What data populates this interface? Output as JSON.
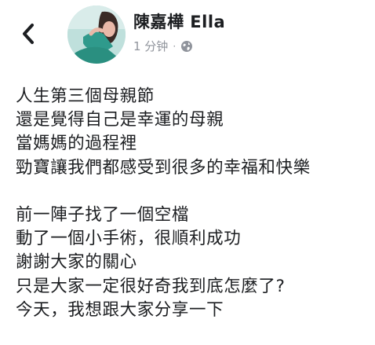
{
  "post": {
    "author_name": "陳嘉樺 Ella",
    "timestamp": "1 分钟",
    "separator": "·",
    "privacy_icon": "globe-icon",
    "paragraphs": [
      [
        "人生第三個母親節",
        "還是覺得自己是幸運的母親",
        "當媽媽的過程裡",
        "勁寶讓我們都感受到很多的幸福和快樂"
      ],
      [
        "前一陣子找了一個空檔",
        "動了一個小手術，很順利成功",
        "謝謝大家的關心",
        "只是大家一定很好奇我到底怎麼了?",
        "今天，我想跟大家分享一下"
      ]
    ]
  },
  "nav": {
    "back_icon": "chevron-left-icon"
  },
  "colors": {
    "text": "#1c1e21",
    "meta": "#90949c",
    "background": "#ffffff"
  }
}
